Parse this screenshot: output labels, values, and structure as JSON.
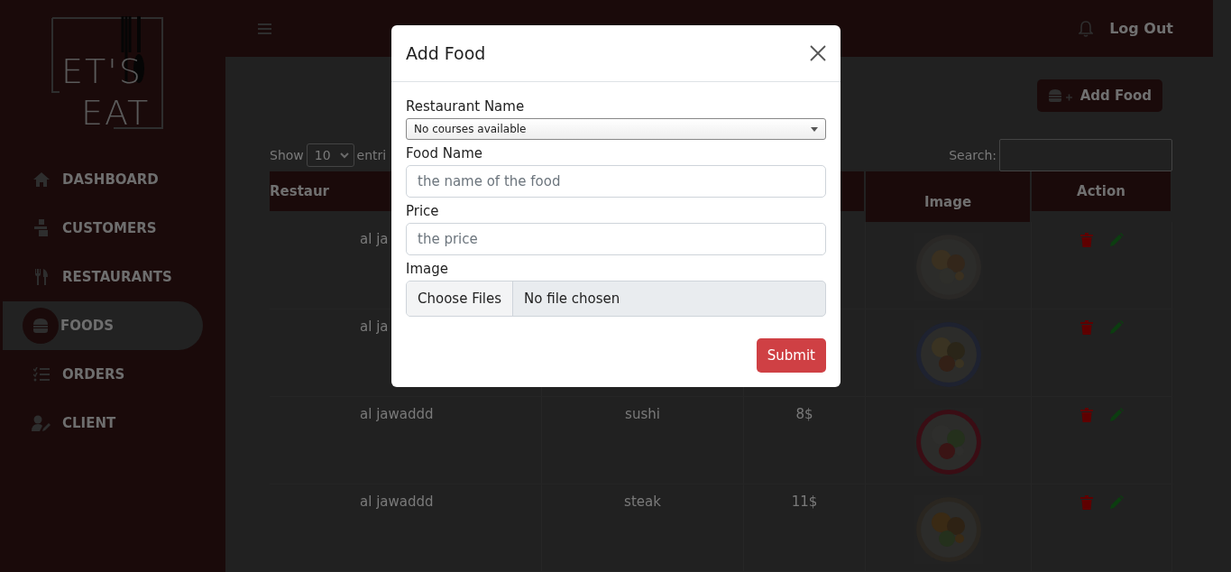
{
  "sidebar": {
    "logo": {
      "line_1": "ET'S",
      "line_2": "EAT"
    },
    "items": [
      {
        "label": "DASHBOARD",
        "selected": false
      },
      {
        "label": "CUSTOMERS",
        "selected": false
      },
      {
        "label": "RESTAURANTS",
        "selected": false
      },
      {
        "label": "FOODS",
        "selected": true
      },
      {
        "label": "ORDERS",
        "selected": false
      },
      {
        "label": "CLIENT",
        "selected": false
      }
    ]
  },
  "topbar": {
    "logout": "Log Out"
  },
  "add_button": {
    "label": "Add Food"
  },
  "table_controls": {
    "show_label": "Show",
    "page_size": "10",
    "entries_label": "entri",
    "search_label": "Search:"
  },
  "table": {
    "headers": {
      "column_1": "Restaur",
      "image": "Image",
      "action": "Action"
    },
    "rows": [
      {
        "restaurant": "al ja"
      },
      {
        "restaurant": "al ja"
      },
      {
        "restaurant": "al jawaddd",
        "food": "sushi",
        "price": "8$"
      },
      {
        "restaurant": "al jawaddd",
        "food": "steak",
        "price": "11$"
      }
    ]
  },
  "modal": {
    "title": "Add Food",
    "fields": [
      {
        "kind": "select",
        "label": "Restaurant Name",
        "value": "No courses available"
      },
      {
        "kind": "text",
        "label": "Food Name",
        "placeholder": "the name of the food"
      },
      {
        "kind": "text",
        "label": "Price",
        "placeholder": "the price"
      },
      {
        "kind": "file",
        "label": "Image",
        "button": "Choose Files",
        "status": "No file chosen"
      }
    ],
    "submit": "Submit"
  }
}
